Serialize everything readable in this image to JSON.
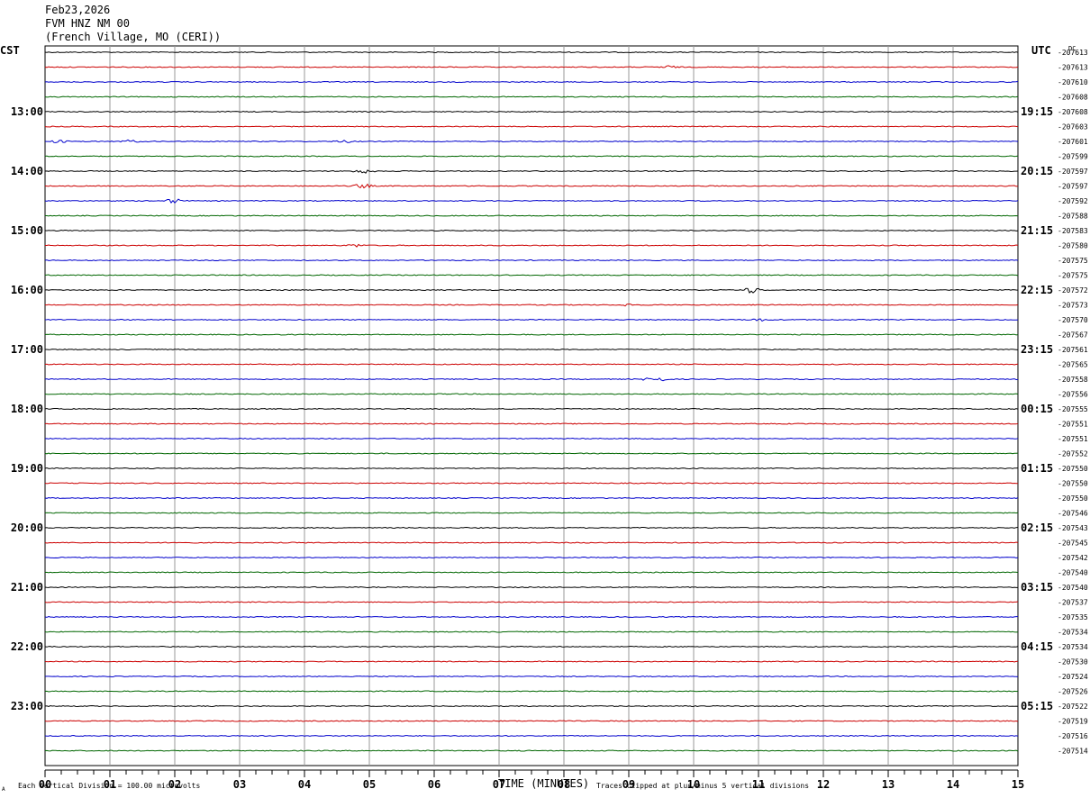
{
  "header": {
    "date": "Feb23,2026",
    "station": "FVM HNZ NM 00",
    "location": "(French Village, MO (CERI))"
  },
  "left_timezone": "CST",
  "right_timezone": "UTC",
  "dc_label": "DC",
  "footer": {
    "xlabel": "TIME (MINUTES)",
    "scale_note": "Each Vertical Division = 100.00 microvolts",
    "clip_note": "Traces clipped at plus/minus 5 vertical divisions",
    "corner_mark": "A"
  },
  "colors": {
    "trace_cycle": [
      "#000000",
      "#cc0000",
      "#0000cc",
      "#006600"
    ],
    "grid": "#999999"
  },
  "chart_data": {
    "type": "line",
    "title": "FVM HNZ NM 00",
    "xlabel": "TIME (MINUTES)",
    "xlim": [
      0,
      15
    ],
    "x_ticks": [
      "00",
      "01",
      "02",
      "03",
      "04",
      "05",
      "06",
      "07",
      "08",
      "09",
      "10",
      "11",
      "12",
      "13",
      "14",
      "15"
    ],
    "left_hour_labels": [
      "13:00",
      "14:00",
      "15:00",
      "16:00",
      "17:00",
      "18:00",
      "19:00",
      "20:00",
      "21:00",
      "22:00",
      "23:00"
    ],
    "right_hour_labels": [
      "19:15",
      "20:15",
      "21:15",
      "22:15",
      "23:15",
      "00:15",
      "01:15",
      "02:15",
      "03:15",
      "04:15",
      "05:15"
    ],
    "trace_dc_offsets": [
      "-207613",
      "-207613",
      "-207610",
      "-207608",
      "-207608",
      "-207603",
      "-207601",
      "-207599",
      "-207597",
      "-207597",
      "-207592",
      "-207588",
      "-207583",
      "-207580",
      "-207575",
      "-207575",
      "-207572",
      "-207573",
      "-207570",
      "-207567",
      "-207561",
      "-207565",
      "-207558",
      "-207556",
      "-207555",
      "-207551",
      "-207551",
      "-207552",
      "-207550",
      "-207550",
      "-207550",
      "-207546",
      "-207543",
      "-207545",
      "-207542",
      "-207540",
      "-207540",
      "-207537",
      "-207535",
      "-207534",
      "-207534",
      "-207530",
      "-207524",
      "-207526",
      "-207522",
      "-207519",
      "-207516",
      "-207514"
    ],
    "events": [
      {
        "trace": 1,
        "minute": 9.6,
        "amplitude": 2
      },
      {
        "trace": 6,
        "minute": 0.2,
        "amplitude": 2
      },
      {
        "trace": 6,
        "minute": 1.3,
        "amplitude": 2
      },
      {
        "trace": 6,
        "minute": 4.6,
        "amplitude": 2
      },
      {
        "trace": 8,
        "minute": 4.9,
        "amplitude": 3
      },
      {
        "trace": 9,
        "minute": 4.9,
        "amplitude": 3
      },
      {
        "trace": 10,
        "minute": 2.0,
        "amplitude": 3
      },
      {
        "trace": 13,
        "minute": 4.8,
        "amplitude": 2
      },
      {
        "trace": 16,
        "minute": 10.9,
        "amplitude": 4
      },
      {
        "trace": 17,
        "minute": 9.0,
        "amplitude": 2
      },
      {
        "trace": 18,
        "minute": 11.0,
        "amplitude": 2
      },
      {
        "trace": 22,
        "minute": 9.4,
        "amplitude": 4
      }
    ]
  }
}
